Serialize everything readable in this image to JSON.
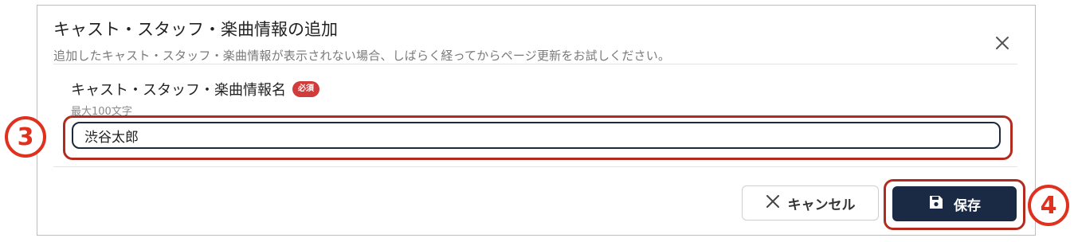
{
  "dialog": {
    "title": "キャスト・スタッフ・楽曲情報の追加",
    "subtitle": "追加したキャスト・スタッフ・楽曲情報が表示されない場合、しばらく経ってからページ更新をお試しください。"
  },
  "field": {
    "label": "キャスト・スタッフ・楽曲情報名",
    "required_badge": "必須",
    "hint": "最大100文字",
    "value": "渋谷太郎"
  },
  "buttons": {
    "cancel_label": "キャンセル",
    "save_label": "保存"
  },
  "annotations": {
    "step3": "3",
    "step4": "4",
    "color": "#e0301e"
  },
  "colors": {
    "primary": "#1b2a44",
    "required": "#d03b3b",
    "highlight": "#b32a1e"
  }
}
